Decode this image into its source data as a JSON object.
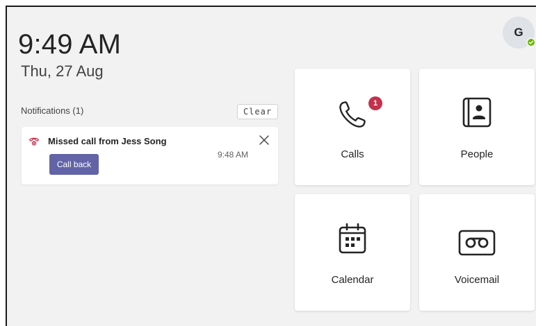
{
  "clock": {
    "time": "9:49 AM",
    "date": "Thu, 27 Aug"
  },
  "user": {
    "avatar_initial": "G",
    "presence": "available",
    "presence_color": "#6bb700"
  },
  "notifications": {
    "title": "Notifications (1)",
    "clear_label": "Clear",
    "items": [
      {
        "text": "Missed call from Jess Song",
        "time": "9:48 AM",
        "action_label": "Call back",
        "icon": "missed-call-icon"
      }
    ]
  },
  "tiles": [
    {
      "label": "Calls",
      "icon": "phone-icon",
      "badge": "1"
    },
    {
      "label": "People",
      "icon": "contacts-book-icon"
    },
    {
      "label": "Calendar",
      "icon": "calendar-icon"
    },
    {
      "label": "Voicemail",
      "icon": "voicemail-icon"
    }
  ],
  "colors": {
    "accent": "#6264a7",
    "badge": "#c4314b",
    "missed_call": "#c4314b"
  }
}
